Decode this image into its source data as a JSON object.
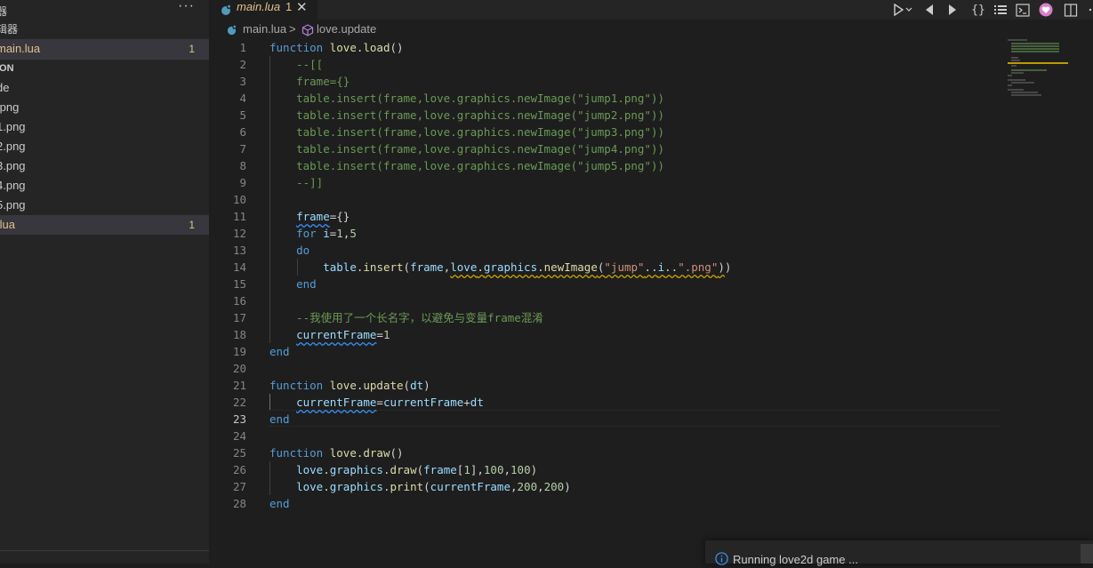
{
  "sidebar": {
    "title": "器",
    "more_label": "···",
    "items": [
      {
        "label": "辑器",
        "count": "",
        "state": "section"
      },
      {
        "label": "main.lua",
        "count": "1",
        "state": "selected-warn"
      },
      {
        "label": "ION",
        "count": "",
        "state": "bold"
      },
      {
        "label": "de",
        "count": "",
        "state": "normal"
      },
      {
        "label": ".png",
        "count": "",
        "state": "normal"
      },
      {
        "label": "1.png",
        "count": "",
        "state": "normal"
      },
      {
        "label": "2.png",
        "count": "",
        "state": "normal"
      },
      {
        "label": "3.png",
        "count": "",
        "state": "normal"
      },
      {
        "label": "4.png",
        "count": "",
        "state": "normal"
      },
      {
        "label": "5.png",
        "count": "",
        "state": "normal"
      },
      {
        "label": ".lua",
        "count": "1",
        "state": "selected-warn"
      }
    ]
  },
  "tab": {
    "label": "main.lua",
    "count": "1",
    "close": "✕"
  },
  "breadcrumb": {
    "file": "main.lua",
    "sep": ">",
    "symbol": "love.update"
  },
  "editor": {
    "active_line": "23",
    "line_numbers": [
      "1",
      "2",
      "3",
      "4",
      "5",
      "6",
      "7",
      "8",
      "9",
      "10",
      "11",
      "12",
      "13",
      "14",
      "15",
      "16",
      "17",
      "18",
      "19",
      "20",
      "21",
      "22",
      "23",
      "24",
      "25",
      "26",
      "27",
      "28"
    ]
  },
  "notification": {
    "text": "Running love2d game ..."
  },
  "colors": {
    "accent": "#569cd6",
    "warning": "#e2c08d",
    "comment": "#6a9955",
    "string": "#ce9178"
  }
}
